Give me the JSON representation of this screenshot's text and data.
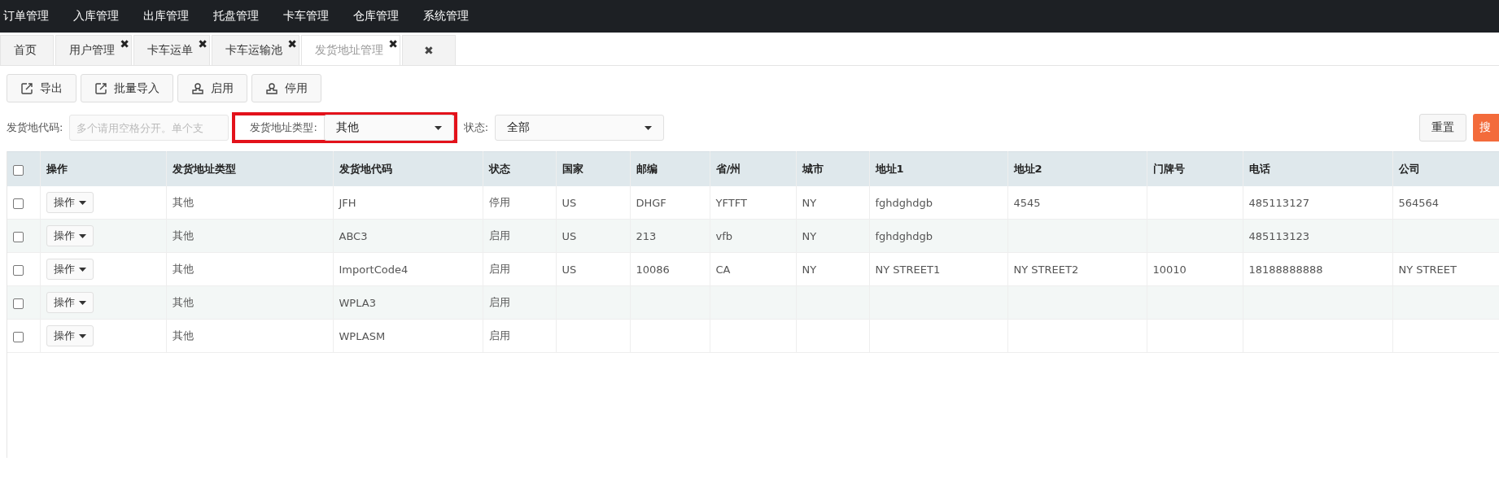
{
  "top_menu": [
    "订单管理",
    "入库管理",
    "出库管理",
    "托盘管理",
    "卡车管理",
    "仓库管理",
    "系统管理"
  ],
  "tabs": [
    {
      "label": "首页",
      "selected": false
    },
    {
      "label": "用户管理",
      "close": "✖",
      "selected": false
    },
    {
      "label": "卡车运单",
      "close": "✖",
      "selected": false
    },
    {
      "label": "卡车运输池",
      "close": "✖",
      "selected": false
    },
    {
      "label": "发货地址管理",
      "close": "✖",
      "selected": true
    },
    {
      "close": "✖",
      "selected": false
    }
  ],
  "toolbar": [
    {
      "label": "导出",
      "kind": "export"
    },
    {
      "label": "批量导入",
      "kind": "export"
    },
    {
      "label": "启用",
      "kind": "user"
    },
    {
      "label": "停用",
      "kind": "user"
    }
  ],
  "filters": {
    "code": {
      "label": "发货地代码:",
      "placeholder": "多个请用空格分开。单个支"
    },
    "type": {
      "label": "发货地址类型:",
      "value": "其他",
      "highlighted": true
    },
    "status": {
      "label": "状态:",
      "value": "全部"
    },
    "reset": "重置",
    "search": "搜"
  },
  "table": {
    "header_checked": false,
    "columns": [
      "操作",
      "发货地址类型",
      "发货地代码",
      "状态",
      "国家",
      "邮编",
      "省/州",
      "城市",
      "地址1",
      "地址2",
      "门牌号",
      "电话",
      "公司"
    ],
    "rows": [
      {
        "checked": false,
        "cells": [
          "操作",
          "其他",
          "JFH",
          "停用",
          "US",
          "DHGF",
          "YFTFT",
          "NY",
          "fghdghdgb",
          "4545",
          "",
          "485113127",
          "564564"
        ]
      },
      {
        "checked": false,
        "cells": [
          "操作",
          "其他",
          "ABC3",
          "启用",
          "US",
          "213",
          "vfb",
          "NY",
          "fghdghdgb",
          "",
          "",
          "485113123",
          ""
        ]
      },
      {
        "checked": false,
        "cells": [
          "操作",
          "其他",
          "ImportCode4",
          "启用",
          "US",
          "10086",
          "CA",
          "NY",
          "NY STREET1",
          "NY STREET2",
          "10010",
          "18188888888",
          "NY STREET"
        ]
      },
      {
        "checked": false,
        "cells": [
          "操作",
          "其他",
          "WPLA3",
          "启用",
          "",
          "",
          "",
          "",
          "",
          "",
          "",
          "",
          ""
        ]
      },
      {
        "checked": false,
        "cells": [
          "操作",
          "其他",
          "WPLASM",
          "启用",
          "",
          "",
          "",
          "",
          "",
          "",
          "",
          "",
          ""
        ]
      }
    ]
  }
}
